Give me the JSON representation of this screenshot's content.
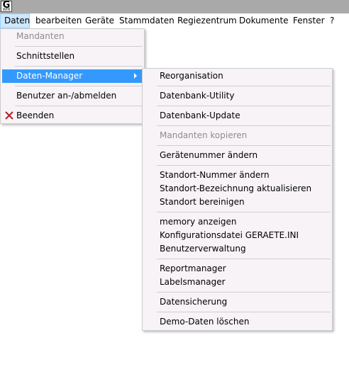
{
  "app_icon": {
    "letter": "G",
    "sub": "WIN"
  },
  "menubar": {
    "items": [
      {
        "label": "Daten"
      },
      {
        "label": "bearbeiten"
      },
      {
        "label": "Geräte"
      },
      {
        "label": "Stammdaten"
      },
      {
        "label": "Regiezentrum"
      },
      {
        "label": "Dokumente"
      },
      {
        "label": "Fenster"
      },
      {
        "label": "?"
      }
    ]
  },
  "daten_menu": {
    "items": [
      {
        "label": "Mandanten",
        "enabled": false
      },
      {
        "label": "Schnittstellen",
        "enabled": true
      },
      {
        "label": "Daten-Manager",
        "enabled": true,
        "submenu": true,
        "highlighted": true
      },
      {
        "label": "Benutzer an-/abmelden",
        "enabled": true
      },
      {
        "label": "Beenden",
        "enabled": true,
        "icon": "close-x-icon"
      }
    ]
  },
  "daten_manager_menu": {
    "items": [
      {
        "label": "Reorganisation",
        "enabled": true
      },
      {
        "label": "Datenbank-Utility",
        "enabled": true
      },
      {
        "label": "Datenbank-Update",
        "enabled": true
      },
      {
        "label": "Mandanten kopieren",
        "enabled": false
      },
      {
        "label": "Gerätenummer ändern",
        "enabled": true
      },
      {
        "label": "Standort-Nummer ändern",
        "enabled": true
      },
      {
        "label": "Standort-Bezeichnung aktualisieren",
        "enabled": true
      },
      {
        "label": "Standort bereinigen",
        "enabled": true
      },
      {
        "label": "memory anzeigen",
        "enabled": true
      },
      {
        "label": "Konfigurationsdatei GERAETE.INI",
        "enabled": true
      },
      {
        "label": "Benutzerverwaltung",
        "enabled": true
      },
      {
        "label": "Reportmanager",
        "enabled": true
      },
      {
        "label": "Labelsmanager",
        "enabled": true
      },
      {
        "label": "Datensicherung",
        "enabled": true
      },
      {
        "label": "Demo-Daten löschen",
        "enabled": true
      }
    ]
  },
  "colors": {
    "titlebar": "#a9a9a9",
    "menu_highlight": "#3399ff",
    "menubar_active": "#cce8ff",
    "beenden_icon": "#b22222"
  }
}
